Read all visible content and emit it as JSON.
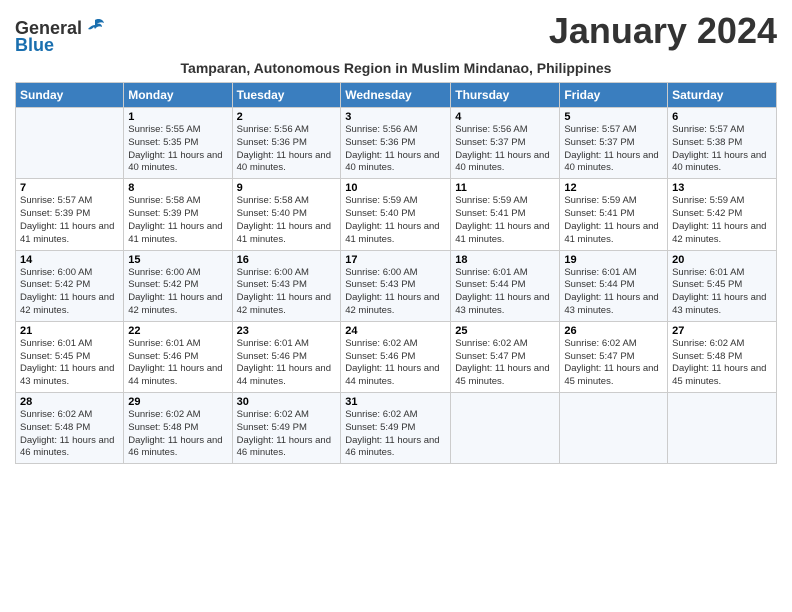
{
  "logo": {
    "general": "General",
    "blue": "Blue"
  },
  "title": "January 2024",
  "subtitle": "Tamparan, Autonomous Region in Muslim Mindanao, Philippines",
  "days_of_week": [
    "Sunday",
    "Monday",
    "Tuesday",
    "Wednesday",
    "Thursday",
    "Friday",
    "Saturday"
  ],
  "weeks": [
    [
      {
        "day": "",
        "sunrise": "",
        "sunset": "",
        "daylight": ""
      },
      {
        "day": "1",
        "sunrise": "Sunrise: 5:55 AM",
        "sunset": "Sunset: 5:35 PM",
        "daylight": "Daylight: 11 hours and 40 minutes."
      },
      {
        "day": "2",
        "sunrise": "Sunrise: 5:56 AM",
        "sunset": "Sunset: 5:36 PM",
        "daylight": "Daylight: 11 hours and 40 minutes."
      },
      {
        "day": "3",
        "sunrise": "Sunrise: 5:56 AM",
        "sunset": "Sunset: 5:36 PM",
        "daylight": "Daylight: 11 hours and 40 minutes."
      },
      {
        "day": "4",
        "sunrise": "Sunrise: 5:56 AM",
        "sunset": "Sunset: 5:37 PM",
        "daylight": "Daylight: 11 hours and 40 minutes."
      },
      {
        "day": "5",
        "sunrise": "Sunrise: 5:57 AM",
        "sunset": "Sunset: 5:37 PM",
        "daylight": "Daylight: 11 hours and 40 minutes."
      },
      {
        "day": "6",
        "sunrise": "Sunrise: 5:57 AM",
        "sunset": "Sunset: 5:38 PM",
        "daylight": "Daylight: 11 hours and 40 minutes."
      }
    ],
    [
      {
        "day": "7",
        "sunrise": "Sunrise: 5:57 AM",
        "sunset": "Sunset: 5:39 PM",
        "daylight": "Daylight: 11 hours and 41 minutes."
      },
      {
        "day": "8",
        "sunrise": "Sunrise: 5:58 AM",
        "sunset": "Sunset: 5:39 PM",
        "daylight": "Daylight: 11 hours and 41 minutes."
      },
      {
        "day": "9",
        "sunrise": "Sunrise: 5:58 AM",
        "sunset": "Sunset: 5:40 PM",
        "daylight": "Daylight: 11 hours and 41 minutes."
      },
      {
        "day": "10",
        "sunrise": "Sunrise: 5:59 AM",
        "sunset": "Sunset: 5:40 PM",
        "daylight": "Daylight: 11 hours and 41 minutes."
      },
      {
        "day": "11",
        "sunrise": "Sunrise: 5:59 AM",
        "sunset": "Sunset: 5:41 PM",
        "daylight": "Daylight: 11 hours and 41 minutes."
      },
      {
        "day": "12",
        "sunrise": "Sunrise: 5:59 AM",
        "sunset": "Sunset: 5:41 PM",
        "daylight": "Daylight: 11 hours and 41 minutes."
      },
      {
        "day": "13",
        "sunrise": "Sunrise: 5:59 AM",
        "sunset": "Sunset: 5:42 PM",
        "daylight": "Daylight: 11 hours and 42 minutes."
      }
    ],
    [
      {
        "day": "14",
        "sunrise": "Sunrise: 6:00 AM",
        "sunset": "Sunset: 5:42 PM",
        "daylight": "Daylight: 11 hours and 42 minutes."
      },
      {
        "day": "15",
        "sunrise": "Sunrise: 6:00 AM",
        "sunset": "Sunset: 5:42 PM",
        "daylight": "Daylight: 11 hours and 42 minutes."
      },
      {
        "day": "16",
        "sunrise": "Sunrise: 6:00 AM",
        "sunset": "Sunset: 5:43 PM",
        "daylight": "Daylight: 11 hours and 42 minutes."
      },
      {
        "day": "17",
        "sunrise": "Sunrise: 6:00 AM",
        "sunset": "Sunset: 5:43 PM",
        "daylight": "Daylight: 11 hours and 42 minutes."
      },
      {
        "day": "18",
        "sunrise": "Sunrise: 6:01 AM",
        "sunset": "Sunset: 5:44 PM",
        "daylight": "Daylight: 11 hours and 43 minutes."
      },
      {
        "day": "19",
        "sunrise": "Sunrise: 6:01 AM",
        "sunset": "Sunset: 5:44 PM",
        "daylight": "Daylight: 11 hours and 43 minutes."
      },
      {
        "day": "20",
        "sunrise": "Sunrise: 6:01 AM",
        "sunset": "Sunset: 5:45 PM",
        "daylight": "Daylight: 11 hours and 43 minutes."
      }
    ],
    [
      {
        "day": "21",
        "sunrise": "Sunrise: 6:01 AM",
        "sunset": "Sunset: 5:45 PM",
        "daylight": "Daylight: 11 hours and 43 minutes."
      },
      {
        "day": "22",
        "sunrise": "Sunrise: 6:01 AM",
        "sunset": "Sunset: 5:46 PM",
        "daylight": "Daylight: 11 hours and 44 minutes."
      },
      {
        "day": "23",
        "sunrise": "Sunrise: 6:01 AM",
        "sunset": "Sunset: 5:46 PM",
        "daylight": "Daylight: 11 hours and 44 minutes."
      },
      {
        "day": "24",
        "sunrise": "Sunrise: 6:02 AM",
        "sunset": "Sunset: 5:46 PM",
        "daylight": "Daylight: 11 hours and 44 minutes."
      },
      {
        "day": "25",
        "sunrise": "Sunrise: 6:02 AM",
        "sunset": "Sunset: 5:47 PM",
        "daylight": "Daylight: 11 hours and 45 minutes."
      },
      {
        "day": "26",
        "sunrise": "Sunrise: 6:02 AM",
        "sunset": "Sunset: 5:47 PM",
        "daylight": "Daylight: 11 hours and 45 minutes."
      },
      {
        "day": "27",
        "sunrise": "Sunrise: 6:02 AM",
        "sunset": "Sunset: 5:48 PM",
        "daylight": "Daylight: 11 hours and 45 minutes."
      }
    ],
    [
      {
        "day": "28",
        "sunrise": "Sunrise: 6:02 AM",
        "sunset": "Sunset: 5:48 PM",
        "daylight": "Daylight: 11 hours and 46 minutes."
      },
      {
        "day": "29",
        "sunrise": "Sunrise: 6:02 AM",
        "sunset": "Sunset: 5:48 PM",
        "daylight": "Daylight: 11 hours and 46 minutes."
      },
      {
        "day": "30",
        "sunrise": "Sunrise: 6:02 AM",
        "sunset": "Sunset: 5:49 PM",
        "daylight": "Daylight: 11 hours and 46 minutes."
      },
      {
        "day": "31",
        "sunrise": "Sunrise: 6:02 AM",
        "sunset": "Sunset: 5:49 PM",
        "daylight": "Daylight: 11 hours and 46 minutes."
      },
      {
        "day": "",
        "sunrise": "",
        "sunset": "",
        "daylight": ""
      },
      {
        "day": "",
        "sunrise": "",
        "sunset": "",
        "daylight": ""
      },
      {
        "day": "",
        "sunrise": "",
        "sunset": "",
        "daylight": ""
      }
    ]
  ]
}
